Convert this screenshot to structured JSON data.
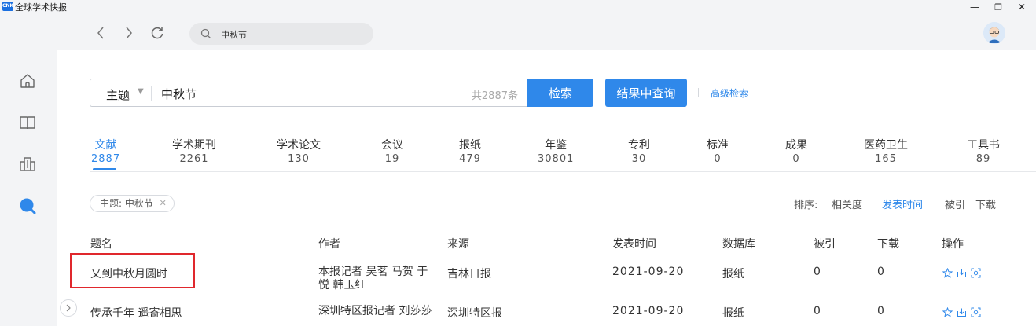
{
  "app": {
    "title": "全球学术快报",
    "logo_text": "CNKI"
  },
  "window_controls": {
    "minimize": "—",
    "maximize": "❐",
    "close": "✕"
  },
  "nav": {
    "search_text": "中秋节"
  },
  "search": {
    "field": "主题",
    "query": "中秋节",
    "count": "共2887条",
    "search_button": "检索",
    "refine_button": "结果中查询",
    "advanced_link": "高级检索"
  },
  "tabs": [
    {
      "label": "文献",
      "count": "2887",
      "active": true
    },
    {
      "label": "学术期刊",
      "count": "2261"
    },
    {
      "label": "学术论文",
      "count": "130"
    },
    {
      "label": "会议",
      "count": "19"
    },
    {
      "label": "报纸",
      "count": "479"
    },
    {
      "label": "年鉴",
      "count": "30801"
    },
    {
      "label": "专利",
      "count": "30"
    },
    {
      "label": "标准",
      "count": "0"
    },
    {
      "label": "成果",
      "count": "0"
    },
    {
      "label": "医药卫生",
      "count": "165"
    },
    {
      "label": "工具书",
      "count": "89"
    }
  ],
  "filter_chip": "主题: 中秋节",
  "sort": {
    "label": "排序:",
    "options": [
      "相关度",
      "发表时间",
      "被引",
      "下载"
    ],
    "active": "发表时间"
  },
  "table": {
    "headers": [
      "题名",
      "作者",
      "来源",
      "发表时间",
      "数据库",
      "被引",
      "下载",
      "操作"
    ],
    "rows": [
      {
        "title": "又到中秋月圆时",
        "author": "本报记者 吴茗 马贺 于悦 韩玉红",
        "source": "吉林日报",
        "date": "2021-09-20",
        "db": "报纸",
        "cited": "0",
        "downloads": "0"
      },
      {
        "title": "传承千年 遥寄相思",
        "author": "深圳特区报记者 刘莎莎",
        "source": "深圳特区报",
        "date": "2021-09-20",
        "db": "报纸",
        "cited": "0",
        "downloads": "0"
      }
    ]
  },
  "colors": {
    "accent": "#2f88ea",
    "highlight": "#e0282d"
  }
}
